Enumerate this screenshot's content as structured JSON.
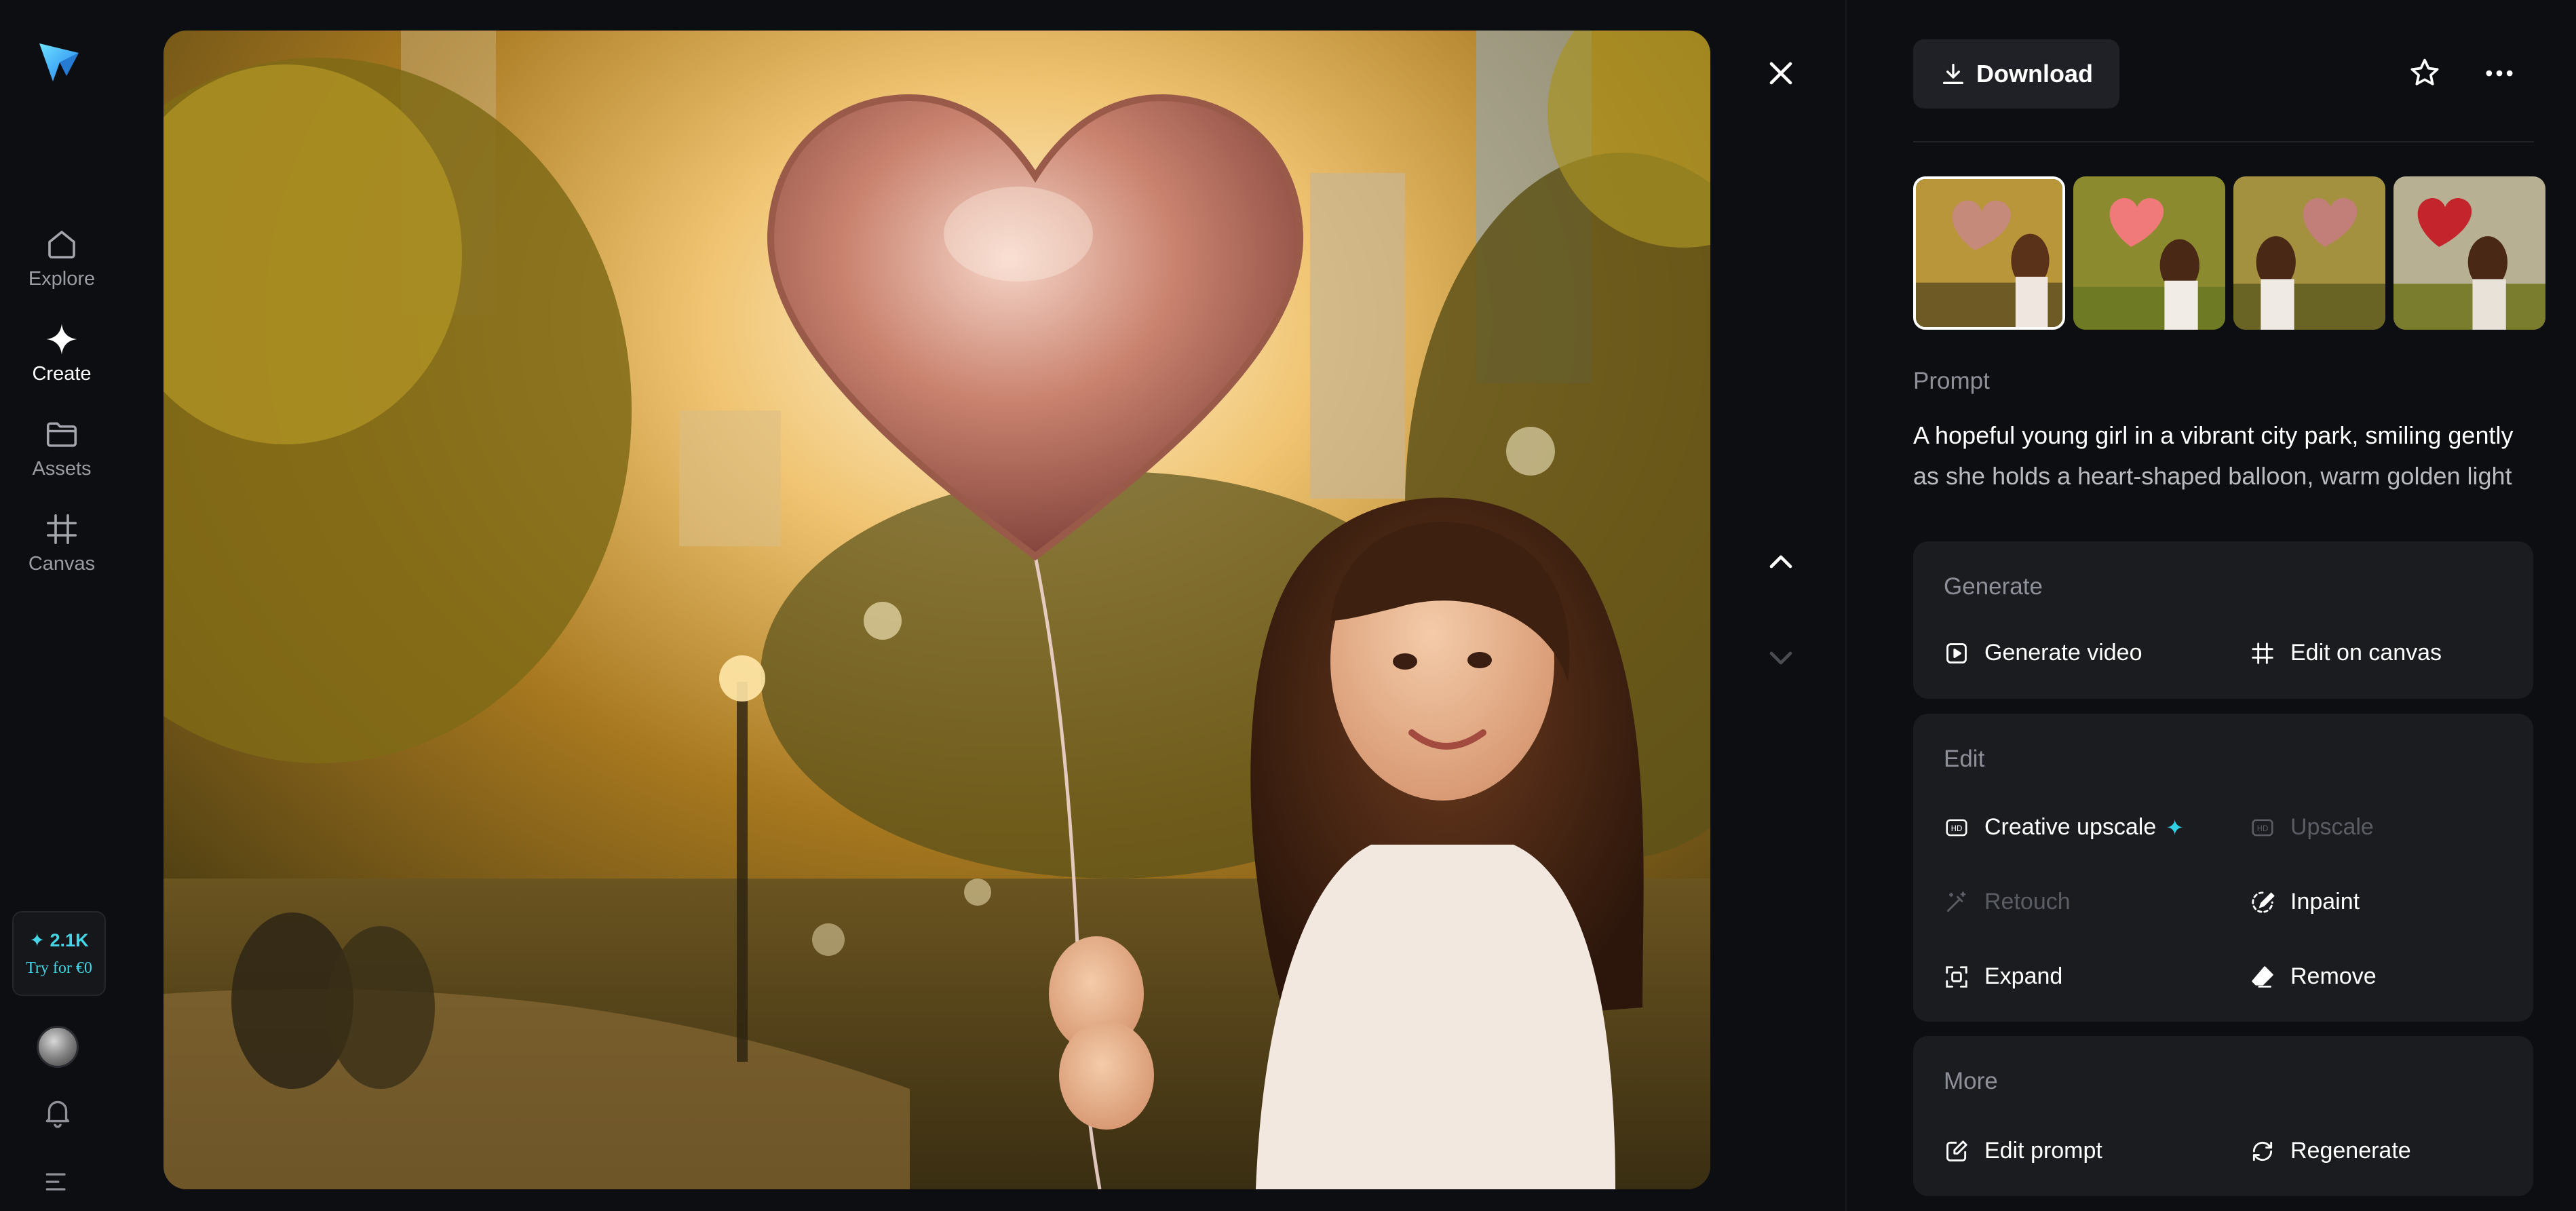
{
  "nav": {
    "items": [
      {
        "label": "Explore",
        "icon": "home-icon"
      },
      {
        "label": "Create",
        "icon": "sparkle-icon",
        "active": true
      },
      {
        "label": "Assets",
        "icon": "folder-icon"
      },
      {
        "label": "Canvas",
        "icon": "canvas-icon"
      }
    ],
    "credits": {
      "amount": "✦ 2.1K",
      "cta": "Try for €0"
    }
  },
  "toolbar": {
    "download_label": "Download"
  },
  "prompt": {
    "label": "Prompt",
    "line1": "A hopeful young girl in a vibrant city park, smiling gently",
    "line2": "as she holds a heart-shaped balloon, warm golden light"
  },
  "generate": {
    "title": "Generate",
    "video": "Generate video",
    "canvas": "Edit on canvas"
  },
  "edit": {
    "title": "Edit",
    "creative_upscale": "Creative upscale",
    "sparkle": "✦",
    "upscale": "Upscale",
    "retouch": "Retouch",
    "inpaint": "Inpaint",
    "expand": "Expand",
    "remove": "Remove"
  },
  "more": {
    "title": "More",
    "edit_prompt": "Edit prompt",
    "regenerate": "Regenerate"
  },
  "colors": {
    "background": "#0d0e11",
    "card": "#1a1c20",
    "accent": "#33cfe4"
  }
}
